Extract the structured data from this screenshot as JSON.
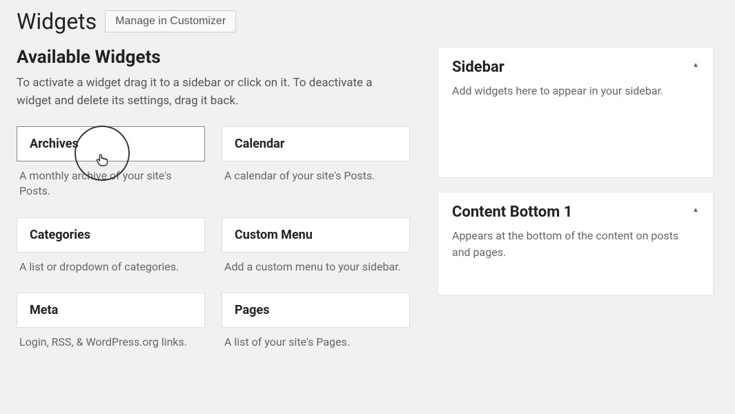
{
  "header": {
    "title": "Widgets",
    "manage_button": "Manage in Customizer"
  },
  "available": {
    "title": "Available Widgets",
    "description": "To activate a widget drag it to a sidebar or click on it. To deactivate a widget and delete its settings, drag it back.",
    "widgets": [
      {
        "name": "Archives",
        "desc": "A monthly archive of your site's Posts."
      },
      {
        "name": "Calendar",
        "desc": "A calendar of your site's Posts."
      },
      {
        "name": "Categories",
        "desc": "A list or dropdown of categories."
      },
      {
        "name": "Custom Menu",
        "desc": "Add a custom menu to your sidebar."
      },
      {
        "name": "Meta",
        "desc": "Login, RSS, & WordPress.org links."
      },
      {
        "name": "Pages",
        "desc": "A list of your site's Pages."
      }
    ]
  },
  "areas": [
    {
      "title": "Sidebar",
      "desc": "Add widgets here to appear in your sidebar."
    },
    {
      "title": "Content Bottom 1",
      "desc": "Appears at the bottom of the content on posts and pages."
    }
  ]
}
